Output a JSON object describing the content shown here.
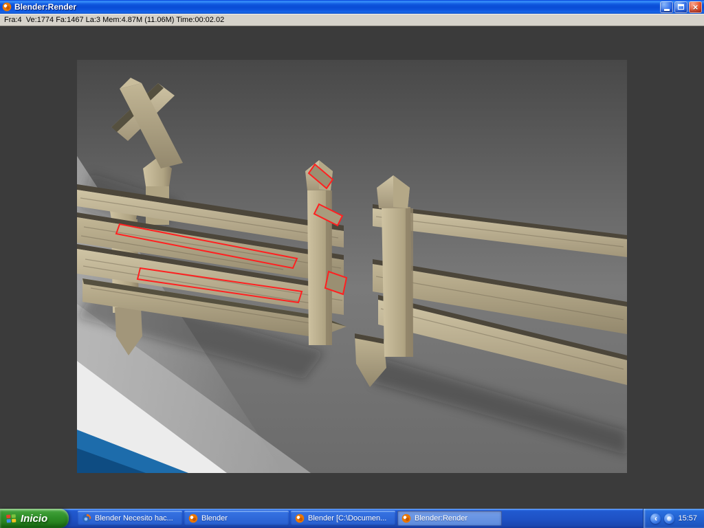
{
  "window": {
    "title": "Blender:Render",
    "controls": {
      "close_glyph": "×"
    }
  },
  "stats_bar": {
    "text": "Fra:4  Ve:1774 Fa:1467 La:3 Mem:4.87M (11.06M) Time:00:02.02"
  },
  "taskbar": {
    "start_label": "Inicio",
    "tasks": [
      {
        "label": "Blender Necesito hac...",
        "icon": "firefox-icon",
        "active": false
      },
      {
        "label": "Blender",
        "icon": "blender-icon",
        "active": false
      },
      {
        "label": "Blender [C:\\Documen...",
        "icon": "blender-icon",
        "active": false
      },
      {
        "label": "Blender:Render",
        "icon": "blender-icon",
        "active": true
      }
    ],
    "tray": {
      "collapse_glyph": "‹",
      "time": "15:57"
    }
  },
  "colors": {
    "selection_outline": "#ff2020",
    "titlebar_blue": "#0a4cd6",
    "statusbar_gray": "#d6d2ca",
    "workspace_gray": "#3b3b3b",
    "taskbar_blue": "#1e51c4",
    "start_green": "#2f8f28",
    "wood_light": "#cfc4a4",
    "wood_dark": "#8e8268",
    "floor_corner_blue": "#1d6cab"
  }
}
